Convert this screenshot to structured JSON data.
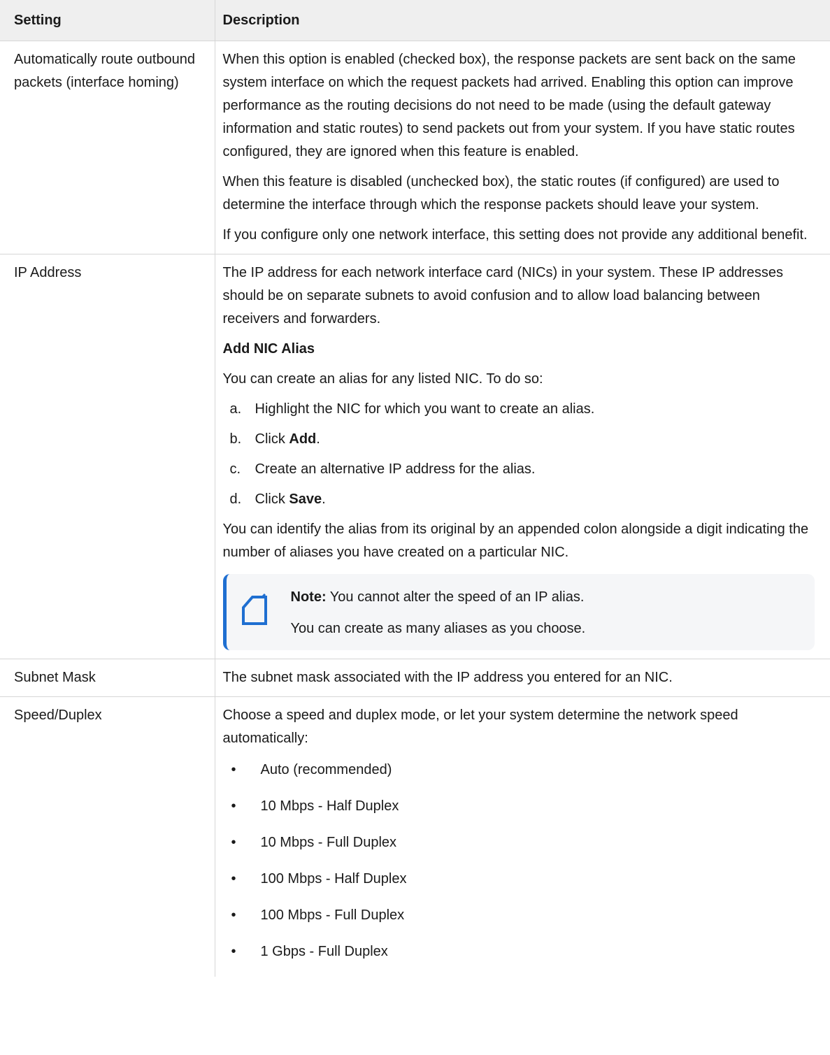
{
  "table": {
    "headers": {
      "setting": "Setting",
      "description": "Description"
    },
    "rows": {
      "interface_homing": {
        "setting": "Automatically route outbound packets (interface homing)",
        "p1": "When this option is enabled (checked box), the response packets are sent back on the same system interface on which the request packets had arrived. Enabling this option can improve performance as the routing decisions do not need to be made (using the default gateway information and static routes) to send packets out from your system. If you have static routes configured, they are ignored when this feature is enabled.",
        "p2": "When this feature is disabled (unchecked box), the static routes (if configured) are used to determine the interface through which the response packets should leave your system.",
        "p3": "If you configure only one network interface, this setting does not provide any additional benefit."
      },
      "ip_address": {
        "setting": "IP Address",
        "p1": "The IP address for each network interface card (NICs) in your system. These IP addresses should be on separate subnets to avoid confusion and to allow load balancing between receivers and forwarders.",
        "heading": "Add NIC Alias",
        "intro": "You can create an alias for any listed NIC. To do so:",
        "steps": [
          {
            "marker": "a.",
            "text": "Highlight the NIC for which you want to create an alias."
          },
          {
            "marker": "b.",
            "text": "Click ",
            "bold": "Add",
            "after": "."
          },
          {
            "marker": "c.",
            "text": "Create an alternative IP address for the alias."
          },
          {
            "marker": "d.",
            "text": "Click ",
            "bold": "Save",
            "after": "."
          }
        ],
        "p2": "You can identify the alias from its original by an appended colon alongside a digit indicating the number of aliases you have created on a particular NIC.",
        "note": {
          "label": "Note:",
          "line1": " You cannot alter the speed of an IP alias.",
          "line2": "You can create as many aliases as you choose.",
          "icon": "note-icon",
          "accent": "#1f6fd1"
        }
      },
      "subnet_mask": {
        "setting": "Subnet Mask",
        "p1": "The subnet mask associated with the IP address you entered for an NIC."
      },
      "speed_duplex": {
        "setting": "Speed/Duplex",
        "p1": "Choose a speed and duplex mode, or let your system determine the network speed automatically:",
        "options": [
          "Auto (recommended)",
          "10 Mbps - Half Duplex",
          "10 Mbps - Full Duplex",
          "100 Mbps - Half Duplex",
          "100 Mbps - Full Duplex",
          "1 Gbps - Full Duplex"
        ],
        "bullet": "•"
      }
    }
  }
}
